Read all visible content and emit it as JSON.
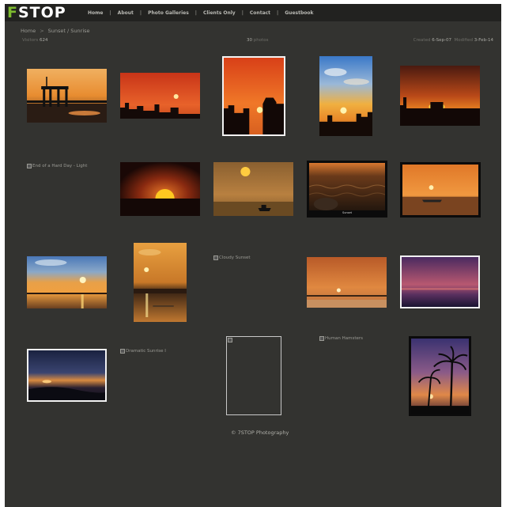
{
  "logo": {
    "f": "F",
    "rest": "STOP"
  },
  "nav": {
    "items": [
      "Home",
      "About",
      "Photo Galleries",
      "Clients Only",
      "Contact",
      "Guestbook"
    ],
    "separator": "|"
  },
  "breadcrumb": {
    "home": "Home",
    "arrow": ">",
    "current": "Sunset / Sunrise"
  },
  "meta": {
    "visitors_label": "Visitors",
    "visitors_value": "624",
    "photos_count": "30",
    "photos_label": "photos",
    "created_label": "Created",
    "created_value": "6-Sep-07",
    "modified_label": "Modified",
    "modified_value": "3-Feb-14"
  },
  "broken_captions": {
    "end_of_day": "End of a Hard Day - Light",
    "cloudy_sunset": "Cloudy Sunset",
    "dramatic_sunrise": "Dramatic Sunrise I",
    "human_hamsters": "Human Hamsters"
  },
  "photo_captions": {
    "black_sunset": "Sunset"
  },
  "footer": {
    "copyright": "© 7STOP Photography"
  },
  "colors": {
    "page_bg": "#333330",
    "header_bg": "#222220",
    "logo_accent": "#7dbb2f",
    "frame_white": "#f2f2f2",
    "frame_black": "#0b0b0b"
  }
}
